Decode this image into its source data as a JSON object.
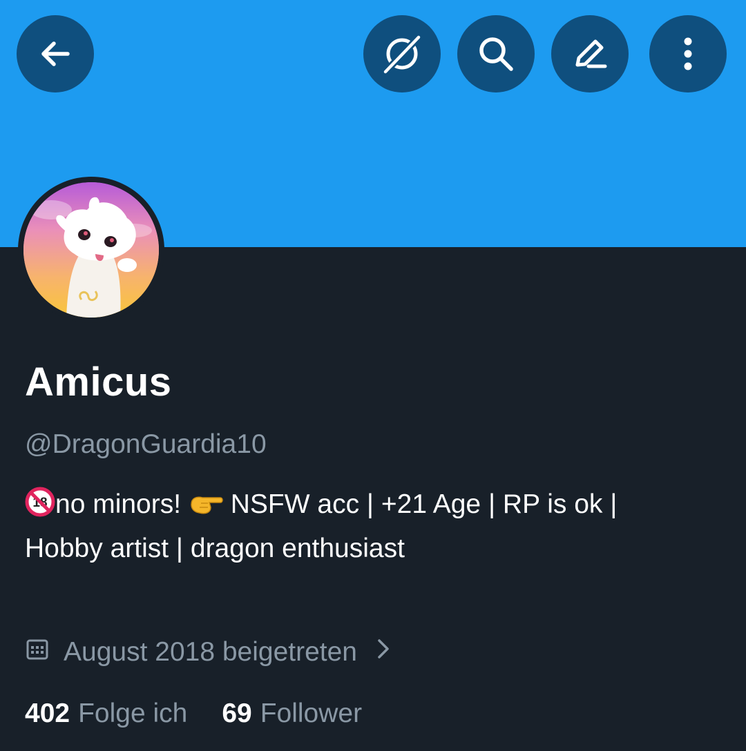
{
  "profile": {
    "name": "Amicus",
    "handle": "@DragonGuardia10",
    "bio_line1_part1": "no minors! ",
    "bio_line1_part2": " NSFW acc | +21 Age | RP is ok |",
    "bio_line2": "Hobby artist | dragon enthusiast",
    "joined": "August 2018 beigetreten",
    "following_count": "402",
    "following_label": "Folge ich",
    "followers_count": "69",
    "followers_label": "Follower"
  },
  "icons": {
    "back": "back-arrow-icon",
    "grok": "grok-icon",
    "search": "search-icon",
    "edit": "edit-pencil-icon",
    "more": "more-vertical-icon",
    "calendar": "calendar-icon",
    "chevron": "chevron-right-icon"
  },
  "colors": {
    "banner": "#1d9bf0",
    "background": "#182029",
    "button_bg": "#0f4f7e",
    "secondary_text": "#8a98a5"
  }
}
